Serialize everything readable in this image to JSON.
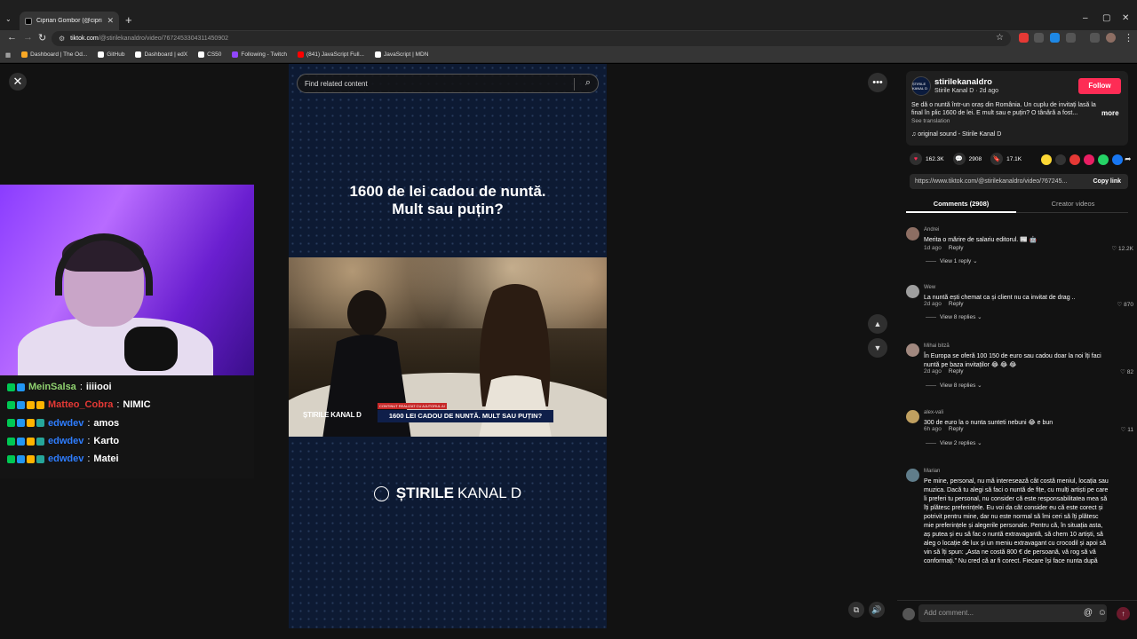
{
  "browser": {
    "tab_title": "Ciprian Gombor (@ciprian...",
    "url_host": "tiktok.com",
    "url_path": "/@stirilekanaldro/video/7672453304311450902",
    "bookmarks": [
      {
        "label": "Dashboard | The Od...",
        "color": "#f9a825"
      },
      {
        "label": "GitHub",
        "color": "#ffffff"
      },
      {
        "label": "Dashboard | edX",
        "color": "#ffffff"
      },
      {
        "label": "CS50",
        "color": "#ffffff"
      },
      {
        "label": "Following - Twitch",
        "color": "#9146ff"
      },
      {
        "label": "(841) JavaScript Full...",
        "color": "#ff0000"
      },
      {
        "label": "JavaScript | MDN",
        "color": "#ffffff"
      }
    ]
  },
  "search": {
    "placeholder": "Find related content"
  },
  "video": {
    "headline_line1": "1600 de lei cadou de nuntă.",
    "headline_line2": "Mult sau puțin?",
    "lower_third": "1600 LEI CADOU DE NUNTĂ. MULT SAU PUȚIN?",
    "lower_third_tag": "CONTINUT REALIZAT CU AJUTORUL AI",
    "lower_third_logo": "ȘTIRILE KANAL D",
    "brand_bold": "ȘTIRILE",
    "brand_light": "KANAL D"
  },
  "chat": [
    {
      "user": "MeinSalsa",
      "color": "#8fd16f",
      "msg": "iiiiooi",
      "badges": [
        "#00c853",
        "#2196f3"
      ]
    },
    {
      "user": "Matteo_Cobra",
      "color": "#e53935",
      "msg": "NIMIC",
      "badges": [
        "#00c853",
        "#2196f3",
        "#ffb300",
        "#ffb300"
      ]
    },
    {
      "user": "edwdev",
      "color": "#2e7dff",
      "msg": "amos",
      "badges": [
        "#00c853",
        "#2196f3",
        "#ffb300",
        "#26a69a"
      ]
    },
    {
      "user": "edwdev",
      "color": "#2e7dff",
      "msg": "Karto",
      "badges": [
        "#00c853",
        "#2196f3",
        "#ffb300",
        "#26a69a"
      ]
    },
    {
      "user": "edwdev",
      "color": "#2e7dff",
      "msg": "Matei",
      "badges": [
        "#00c853",
        "#2196f3",
        "#ffb300",
        "#26a69a"
      ]
    }
  ],
  "profile": {
    "avatar_text": "ȘTIRILE KANAL D",
    "username": "stirilekanaldro",
    "subline": "Stirile Kanal D · 2d ago",
    "follow_label": "Follow",
    "description": "Se dă o nuntă într-un oraș din România. Un cuplu de invitați lasă la final în plic 1600 de lei. E mult sau e puțin? O tânără a fost...",
    "see_translation": "See translation",
    "more": "more",
    "sound": "original sound - Stirile Kanal D"
  },
  "stats": {
    "likes": "162.3K",
    "comments": "2908",
    "saves": "17.1K"
  },
  "link": {
    "url": "https://www.tiktok.com/@stirilekanaldro/video/767245...",
    "copy_label": "Copy link"
  },
  "tabs": {
    "comments": "Comments (2908)",
    "creator": "Creator videos"
  },
  "comments": [
    {
      "user": "Andrei",
      "text": "Merita o mărire de salariu editorul. 📰 🤖",
      "date": "1d ago",
      "likes": "12.2K",
      "replies": "View 1 reply ⌄",
      "avatar": "#8d6e63"
    },
    {
      "user": "Wew",
      "text": "La nuntă ești chemat ca și client nu ca invitat de drag ..",
      "date": "2d ago",
      "likes": "870",
      "replies": "View 8 replies ⌄",
      "avatar": "#9e9e9e"
    },
    {
      "user": "Mihai bitză",
      "text": "În Europa se oferă 100 150 de euro sau cadou doar la noi îți faci nuntă pe baza invitaților 😂 😂 😂",
      "date": "2d ago",
      "likes": "82",
      "replies": "View 8 replies ⌄",
      "avatar": "#a1887f"
    },
    {
      "user": "alex-vali",
      "text": "300 de euro la o nunta sunteti nebuni 😂 e bun",
      "date": "6h ago",
      "likes": "11",
      "replies": "View 2 replies ⌄",
      "avatar": "#c0a060"
    },
    {
      "user": "Marian",
      "text": "Pe mine, personal, nu mă interesează cât costă meniul, locația sau muzica. Dacă tu alegi să faci o nuntă de fițe, cu mulți artiști pe care îi preferi tu personal, nu consider că este responsabilitatea mea să îți plătesc preferințele. Eu voi da cât consider eu că este corect și potrivit pentru mine, dar nu este normal să îmi ceri să îți plătesc mie preferințele și alegerile personale. Pentru că, în situația asta, aș putea și eu să fac o nuntă extravagantă, să chem 10 artiști, să aleg o locație de lux și un meniu extravagant cu crocodil și apoi să vin să îți spun: „Asta ne costă 800 € de persoană, vă rog să vă conformați.” Nu cred că ar fi corect. Fiecare își face nunta după",
      "date": "",
      "likes": "",
      "replies": "",
      "avatar": "#607d8b"
    }
  ],
  "add_comment": {
    "placeholder": "Add comment..."
  }
}
